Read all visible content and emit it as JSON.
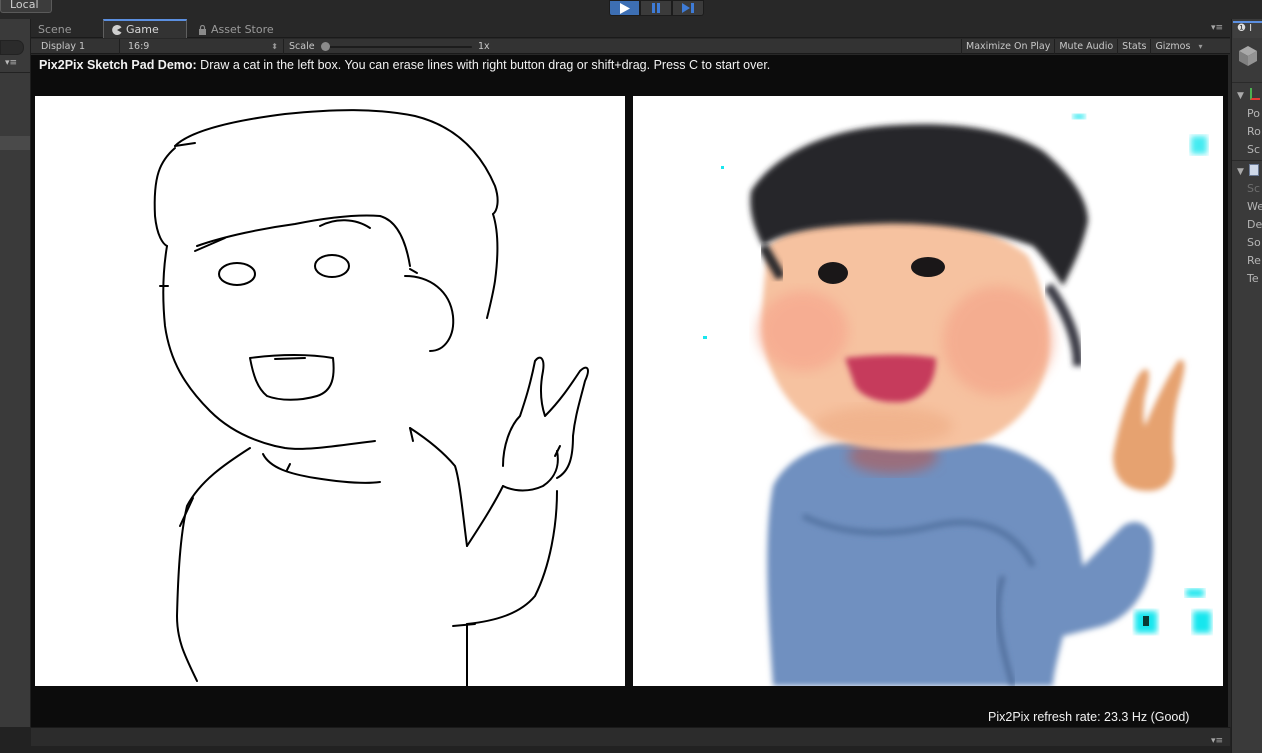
{
  "top_bar": {
    "account_label": "Local",
    "play_label": "▶",
    "pause_label": "❚❚",
    "step_label": "▶❚"
  },
  "tabs": {
    "scene": "Scene",
    "game": "Game",
    "asset_store": "Asset Store"
  },
  "game_toolbar": {
    "display": "Display 1",
    "aspect": "16:9",
    "scale_label": "Scale",
    "scale_value": "1x",
    "scale_fraction": 0.0,
    "maximize": "Maximize On Play",
    "mute": "Mute Audio",
    "stats": "Stats",
    "gizmos": "Gizmos"
  },
  "game_view": {
    "instruction_title": "Pix2Pix Sketch Pad Demo:",
    "instruction_text": " Draw a cat in the left box. You can erase lines with right button drag or shift+drag. Press C to start over.",
    "refresh_rate": "Pix2Pix refresh rate: 23.3 Hz (Good)"
  },
  "inspector": {
    "tab_label": "❶ I",
    "transform_rows": [
      "Po",
      "Ro",
      "Sc"
    ],
    "component_rows": [
      "Sc",
      "We",
      "De",
      "So",
      "Re",
      "Te"
    ]
  },
  "colors": {
    "accent": "#3d6fb4",
    "panel": "#3a3a3a",
    "game_bg": "#0c0c0c"
  },
  "icons": {
    "play": "play-icon",
    "pause": "pause-icon",
    "step": "step-icon",
    "game_tab": "pacman-game-icon",
    "asset_store_tab": "lock-icon",
    "tab_menu": "panel-menu-icon",
    "inspector_cube": "cube-icon"
  }
}
